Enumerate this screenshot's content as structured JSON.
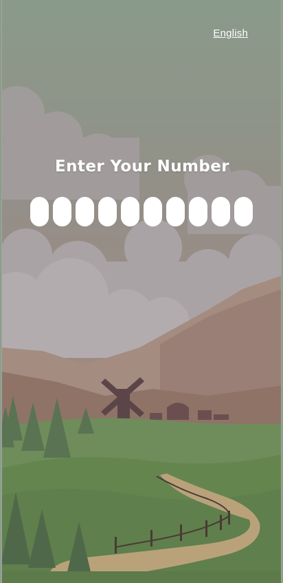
{
  "header": {
    "language_label": "English"
  },
  "form": {
    "title": "Enter Your Number",
    "digit_count": 10,
    "digits": [
      "",
      "",
      "",
      "",
      "",
      "",
      "",
      "",
      "",
      ""
    ]
  },
  "background": {
    "scene": "countryside-illustration",
    "sky_top": "#8a9a8c",
    "sky_bottom": "#9c8b82",
    "cloud": "#b0a7a8",
    "mountain": "#a88e80",
    "meadow": "#6f8f5a",
    "path": "#b9a27a",
    "tree": "#556f50",
    "windmill": "#5b4548"
  }
}
